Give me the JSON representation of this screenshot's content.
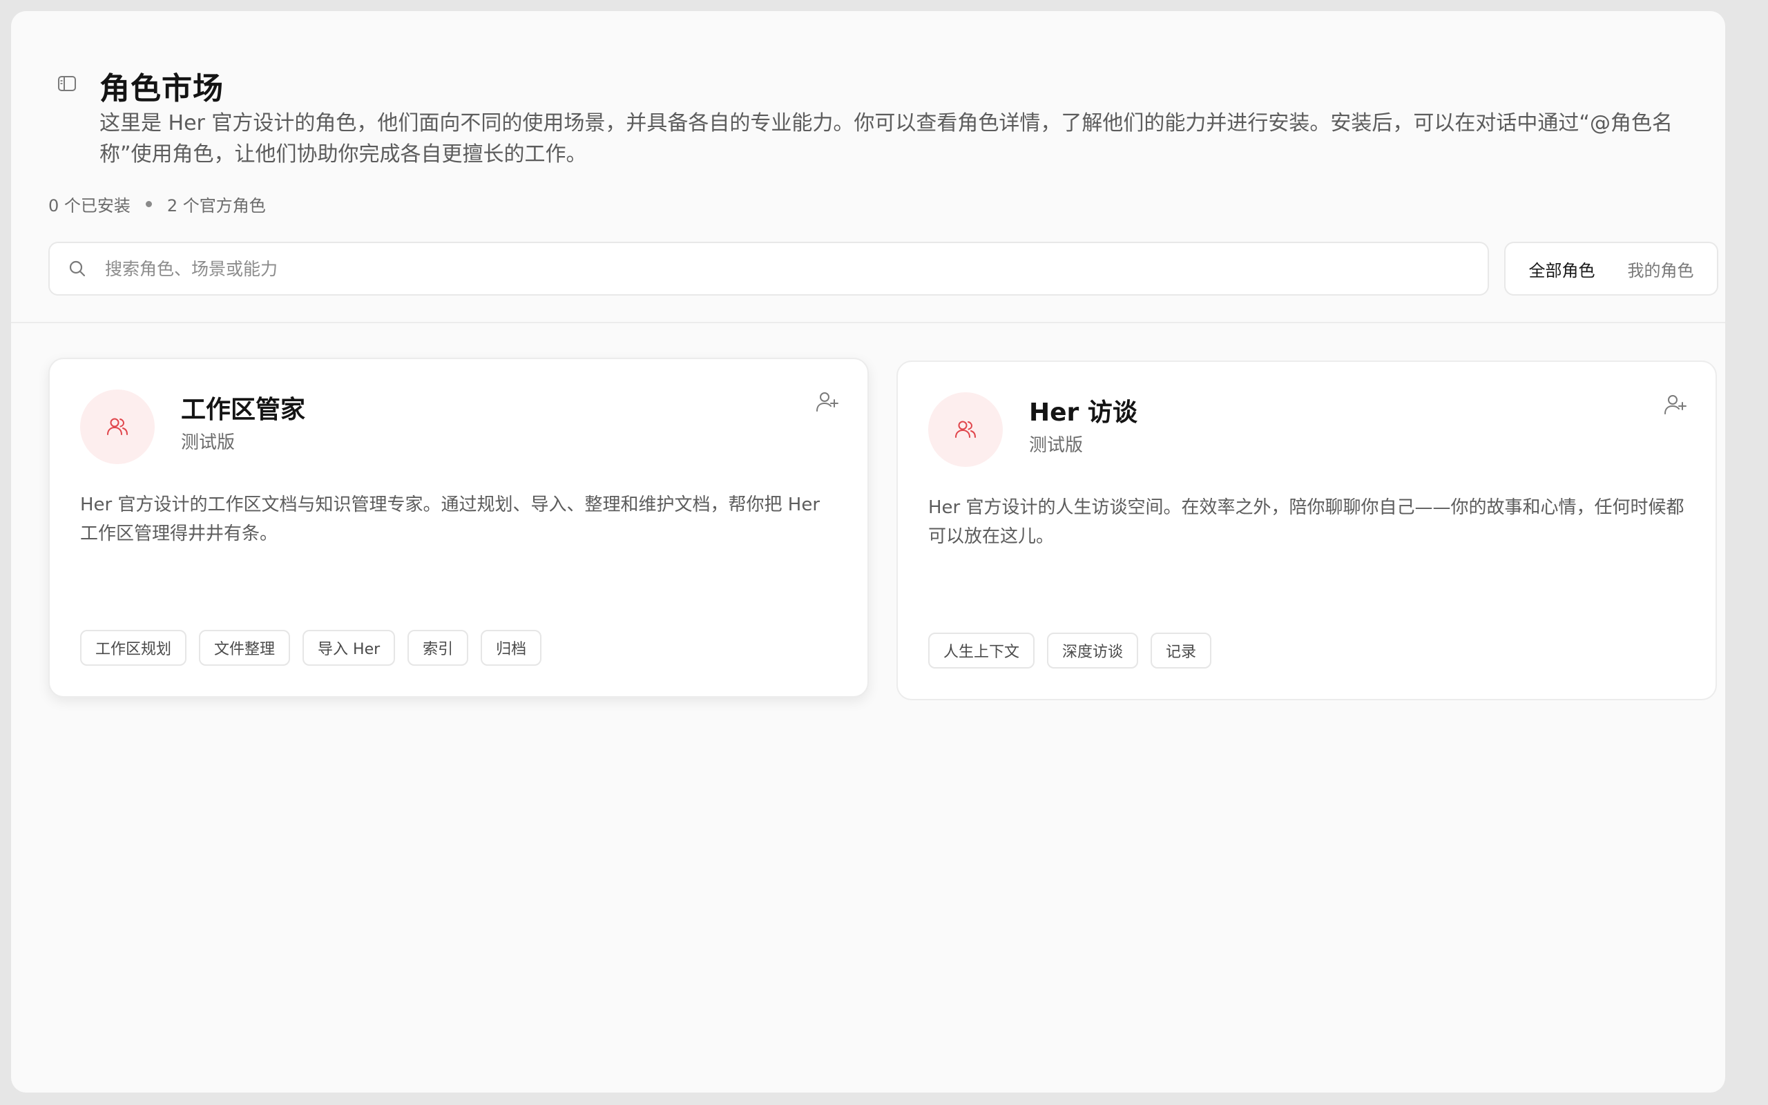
{
  "page": {
    "title": "角色市场",
    "description": "这里是 Her 官方设计的角色，他们面向不同的使用场景，并具备各自的专业能力。你可以查看角色详情，了解他们的能力并进行安装。安装后，可以在对话中通过“@角色名称”使用角色，让他们协助你完成各自更擅长的工作。"
  },
  "stats": {
    "installed": "0 个已安装",
    "official": "2 个官方角色"
  },
  "search": {
    "placeholder": "搜索角色、场景或能力",
    "value": ""
  },
  "filters": {
    "all": "全部角色",
    "mine": "我的角色",
    "active": "all"
  },
  "roles": [
    {
      "name": "工作区管家",
      "badge": "测试版",
      "description": "Her 官方设计的工作区文档与知识管理专家。通过规划、导入、整理和维护文档，帮你把 Her 工作区管理得井井有条。",
      "tags": [
        "工作区规划",
        "文件整理",
        "导入 Her",
        "索引",
        "归档"
      ]
    },
    {
      "name": "Her 访谈",
      "badge": "测试版",
      "description": "Her 官方设计的人生访谈空间。在效率之外，陪你聊聊你自己——你的故事和心情，任何时候都可以放在这儿。",
      "tags": [
        "人生上下文",
        "深度访谈",
        "记录"
      ]
    }
  ],
  "colors": {
    "accent": "#e0454b",
    "avatar_bg": "#fdeeee",
    "background": "#fafafa"
  },
  "icons": {
    "sidebar_toggle": "sidebar-toggle-icon",
    "search": "search-icon",
    "avatar": "users-icon",
    "install": "user-plus-icon"
  }
}
